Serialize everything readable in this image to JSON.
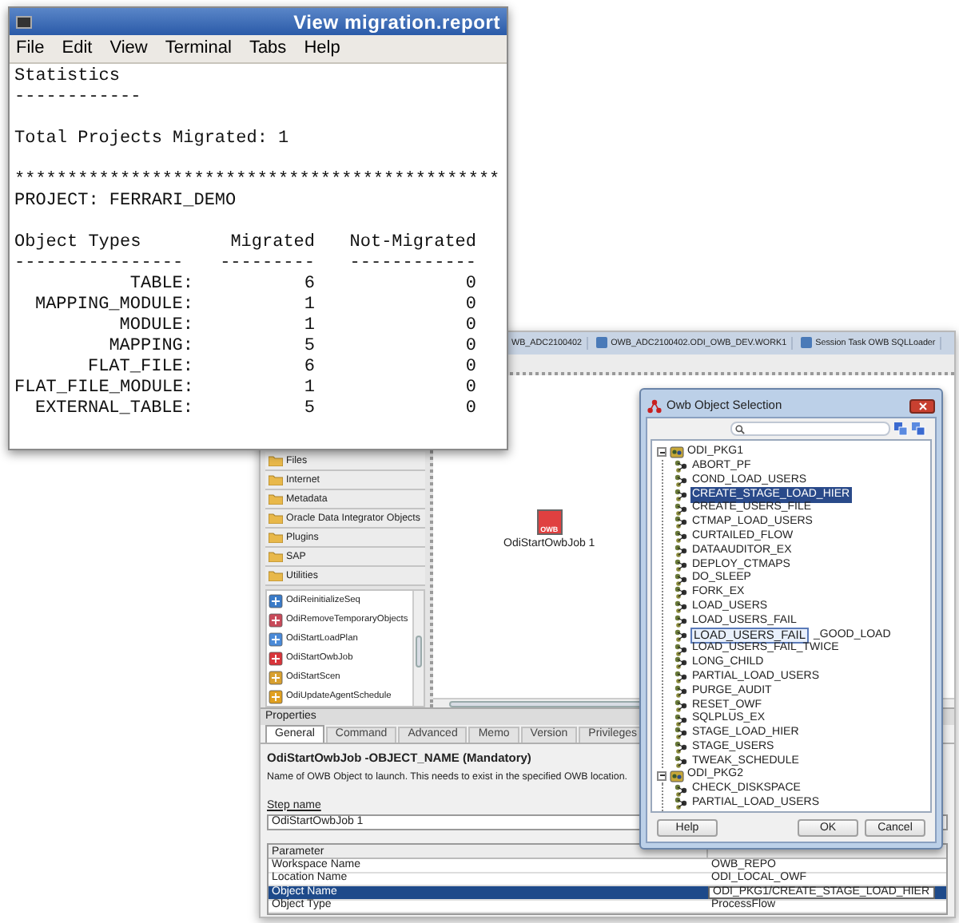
{
  "terminal": {
    "title": "View migration.report",
    "menu": [
      "File",
      "Edit",
      "View",
      "Terminal",
      "Tabs",
      "Help"
    ],
    "heading": "Statistics",
    "heading_rule": "------------",
    "total": "Total Projects Migrated: 1",
    "separator": "**********************************************",
    "project": "PROJECT: FERRARI_DEMO",
    "table": {
      "columns": [
        {
          "label": "Object Types",
          "rule": "----------------"
        },
        {
          "label": "Migrated",
          "rule": "---------"
        },
        {
          "label": "Not-Migrated",
          "rule": "------------"
        }
      ],
      "rows": [
        {
          "type": "TABLE:",
          "migrated": "6",
          "not_migrated": "0"
        },
        {
          "type": "MAPPING_MODULE:",
          "migrated": "1",
          "not_migrated": "0"
        },
        {
          "type": "MODULE:",
          "migrated": "1",
          "not_migrated": "0"
        },
        {
          "type": "MAPPING:",
          "migrated": "5",
          "not_migrated": "0"
        },
        {
          "type": "FLAT_FILE:",
          "migrated": "6",
          "not_migrated": "0"
        },
        {
          "type": "FLAT_FILE_MODULE:",
          "migrated": "1",
          "not_migrated": "0"
        },
        {
          "type": "EXTERNAL_TABLE:",
          "migrated": "5",
          "not_migrated": "0"
        }
      ]
    }
  },
  "ide": {
    "tabs": [
      {
        "label": "WB_ADC2100402"
      },
      {
        "label": "OWB_ADC2100402.ODI_OWB_DEV.WORK1"
      },
      {
        "label": "Session Task OWB SQLLoader"
      }
    ],
    "palette_folders": [
      "Files",
      "Internet",
      "Metadata",
      "Oracle Data Integrator Objects",
      "Plugins",
      "SAP",
      "Utilities"
    ],
    "palette_tools": [
      "OdiReinitializeSeq",
      "OdiRemoveTemporaryObjects",
      "OdiStartLoadPlan",
      "OdiStartOwbJob",
      "OdiStartScen",
      "OdiUpdateAgentSchedule"
    ],
    "canvas_node": {
      "badge": "OWB",
      "label": "OdiStartOwbJob 1"
    },
    "properties": {
      "title": "Properties",
      "tabs": [
        {
          "label": "General",
          "selected": true
        },
        {
          "label": "Command",
          "selected": false
        },
        {
          "label": "Advanced",
          "selected": false
        },
        {
          "label": "Memo",
          "selected": false
        },
        {
          "label": "Version",
          "selected": false
        },
        {
          "label": "Privileges",
          "selected": false
        }
      ],
      "heading": "OdiStartOwbJob -OBJECT_NAME (Mandatory)",
      "description": "Name of OWB Object to launch. This needs to exist in the specified OWB location.",
      "step_label": "Step name",
      "step_value": "OdiStartOwbJob 1",
      "params": {
        "column_1": "Parameter",
        "rows": [
          {
            "name": "Workspace Name",
            "value": "OWB_REPO",
            "selected": false
          },
          {
            "name": "Location Name",
            "value": "ODI_LOCAL_OWF",
            "selected": false
          },
          {
            "name": "Object Name",
            "value": "ODI_PKG1/CREATE_STAGE_LOAD_HIER",
            "selected": true
          },
          {
            "name": "Object Type",
            "value": "ProcessFlow",
            "selected": false
          }
        ]
      }
    }
  },
  "dialog": {
    "title": "Owb Object Selection",
    "tree": [
      {
        "label": "ODI_PKG1",
        "expanded": true,
        "children": [
          {
            "label": "ABORT_PF",
            "selected": false
          },
          {
            "label": "COND_LOAD_USERS",
            "selected": false
          },
          {
            "label": "CREATE_STAGE_LOAD_HIER",
            "selected": true
          },
          {
            "label": "CREATE_USERS_FILE",
            "selected": false
          },
          {
            "label": "CTMAP_LOAD_USERS",
            "selected": false
          },
          {
            "label": "CURTAILED_FLOW",
            "selected": false
          },
          {
            "label": "DATAAUDITOR_EX",
            "selected": false
          },
          {
            "label": "DEPLOY_CTMAPS",
            "selected": false
          },
          {
            "label": "DO_SLEEP",
            "selected": false
          },
          {
            "label": "FORK_EX",
            "selected": false
          },
          {
            "label": "LOAD_USERS",
            "selected": false
          },
          {
            "label": "LOAD_USERS_FAIL",
            "selected": false
          },
          {
            "label": "_GOOD_LOAD",
            "selected": false,
            "tooltip": "LOAD_USERS_FAIL"
          },
          {
            "label": "LOAD_USERS_FAIL_TWICE",
            "selected": false
          },
          {
            "label": "LONG_CHILD",
            "selected": false
          },
          {
            "label": "PARTIAL_LOAD_USERS",
            "selected": false
          },
          {
            "label": "PURGE_AUDIT",
            "selected": false
          },
          {
            "label": "RESET_OWF",
            "selected": false
          },
          {
            "label": "SQLPLUS_EX",
            "selected": false
          },
          {
            "label": "STAGE_LOAD_HIER",
            "selected": false
          },
          {
            "label": "STAGE_USERS",
            "selected": false
          },
          {
            "label": "TWEAK_SCHEDULE",
            "selected": false
          }
        ]
      },
      {
        "label": "ODI_PKG2",
        "expanded": true,
        "children": [
          {
            "label": "CHECK_DISKSPACE",
            "selected": false
          },
          {
            "label": "PARTIAL_LOAD_USERS",
            "selected": false
          }
        ]
      }
    ],
    "buttons": [
      "Help",
      "OK",
      "Cancel"
    ]
  }
}
